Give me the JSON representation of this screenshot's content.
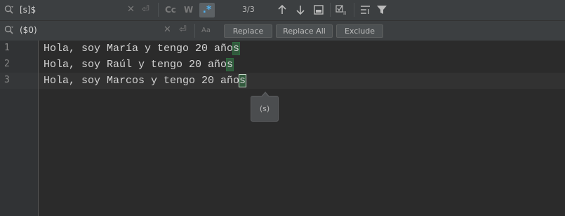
{
  "search": {
    "value": "[s]$",
    "clear_icon": "close-icon",
    "newline_icon": "newline-icon"
  },
  "replace": {
    "value": "($0)",
    "clear_icon": "close-icon",
    "newline_icon": "newline-icon",
    "preserve_case_label": "Aa"
  },
  "options": {
    "match_case": "Cc",
    "words": "W",
    "regex": ".*"
  },
  "counter": "3/3",
  "buttons": {
    "replace": "Replace",
    "replace_all": "Replace All",
    "exclude": "Exclude"
  },
  "editor": {
    "lines": [
      {
        "number": "1",
        "prefix": "Hola, soy María y tengo 20 año",
        "match": "s"
      },
      {
        "number": "2",
        "prefix": "Hola, soy Raúl y tengo 20 año",
        "match": "s"
      },
      {
        "number": "3",
        "prefix": "Hola, soy Marcos y tengo 20 año",
        "match": "s"
      }
    ]
  },
  "tooltip": "(s)",
  "colors": {
    "match_bg": "#32593d",
    "regex_active": "#4fb2f0",
    "background": "#2b2b2b"
  }
}
